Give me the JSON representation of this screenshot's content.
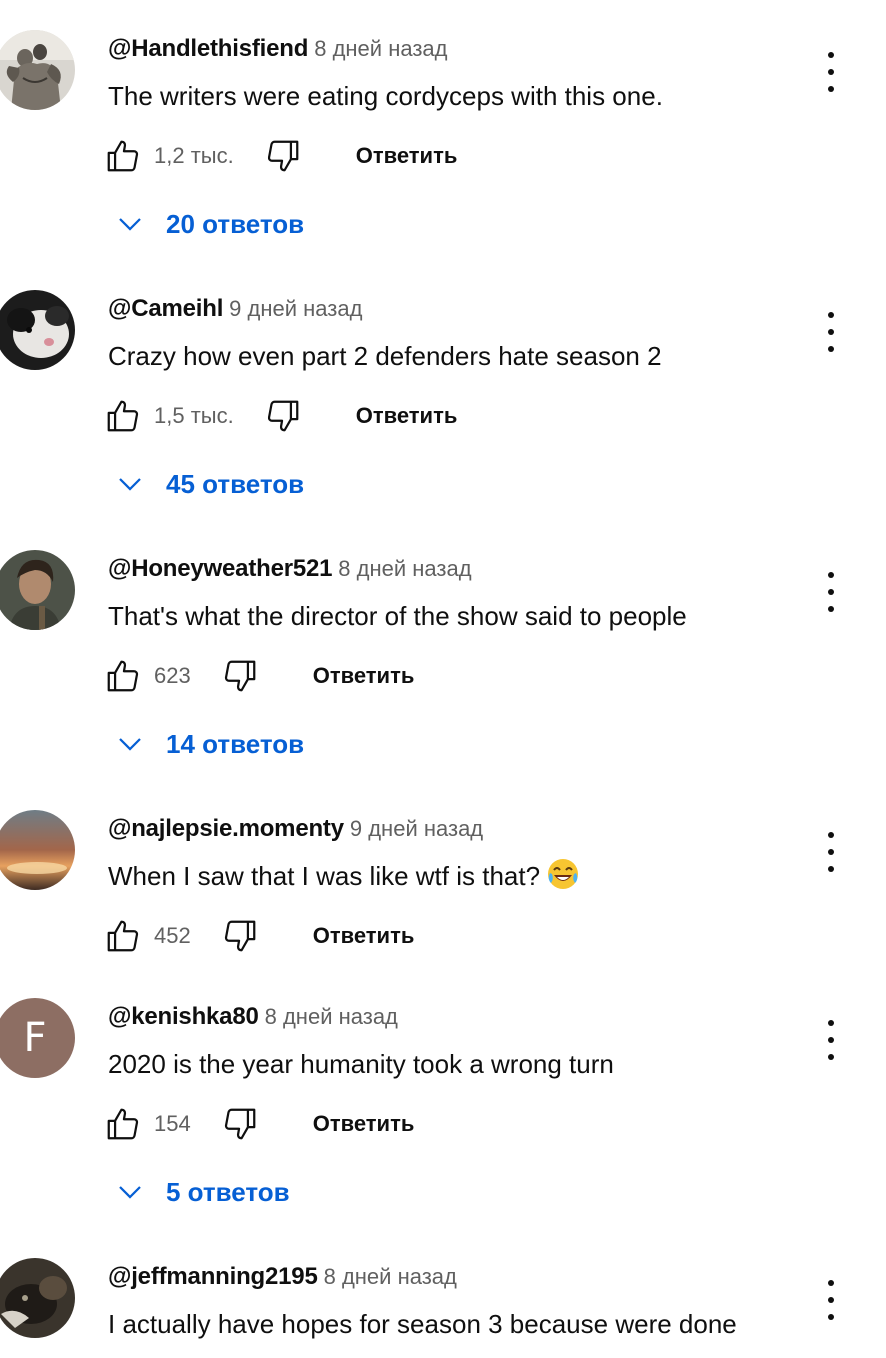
{
  "colors": {
    "text": "#0f0f0f",
    "secondary": "#606060",
    "link": "#065fd4"
  },
  "comments": [
    {
      "author": "@Handlethisfiend",
      "time": "8 дней назад",
      "text": "The writers were eating cordyceps with this one.",
      "likes": "1,2 тыс.",
      "reply_label": "Ответить",
      "replies": "20 ответов",
      "avatar": "bodybuilder-photo"
    },
    {
      "author": "@Cameihl",
      "time": "9 дней назад",
      "text": "Crazy how even part 2 defenders hate season 2",
      "likes": "1,5 тыс.",
      "reply_label": "Ответить",
      "replies": "45 ответов",
      "avatar": "cat-photo"
    },
    {
      "author": "@Honeyweather521",
      "time": "8 дней назад",
      "text": "That's what the director of the show said to people",
      "likes": "623",
      "reply_label": "Ответить",
      "replies": "14 ответов",
      "avatar": "character-portrait"
    },
    {
      "author": "@najlepsie.momenty",
      "time": "9 дней назад",
      "text": "When I saw that I was like wtf is that?",
      "emoji": "face-with-tears-of-joy",
      "likes": "452",
      "reply_label": "Ответить",
      "avatar": "sunset-photo"
    },
    {
      "author": "@kenishka80",
      "time": "8 дней назад",
      "text": "2020 is the year humanity took a wrong turn",
      "likes": "154",
      "reply_label": "Ответить",
      "replies": "5 ответов",
      "avatar_letter": "F",
      "avatar_color": "#8d6e63"
    },
    {
      "author": "@jeffmanning2195",
      "time": "8 дней назад",
      "text": "I actually have hopes for season 3 because were done",
      "avatar": "dark-animal-photo"
    }
  ]
}
